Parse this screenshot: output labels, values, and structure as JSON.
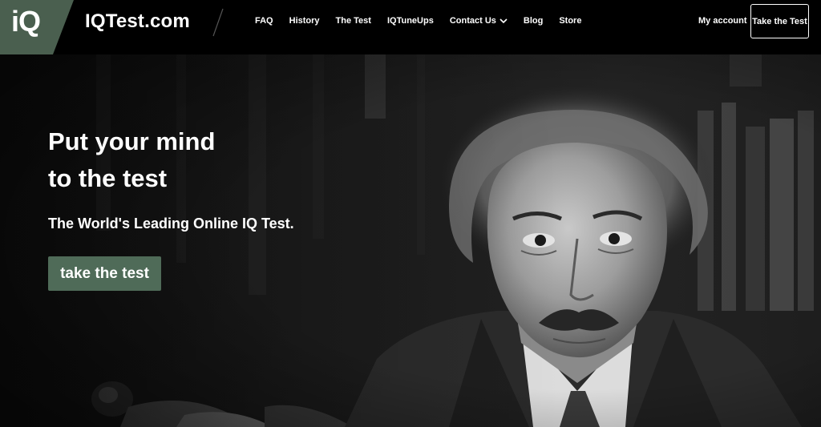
{
  "header": {
    "logo_badge_text": "iQ",
    "brand_name": "IQTest.com",
    "nav": [
      {
        "label": "FAQ"
      },
      {
        "label": "History"
      },
      {
        "label": "The Test"
      },
      {
        "label": "IQTuneUps"
      },
      {
        "label": "Contact Us",
        "has_dropdown": true
      },
      {
        "label": "Blog"
      },
      {
        "label": "Store"
      }
    ],
    "account_label": "My account",
    "cta_label": "Take the Test"
  },
  "hero": {
    "title_line1": "Put your mind",
    "title_line2": "to the test",
    "subtitle": "The World's Leading Online IQ Test.",
    "cta_label": "take the test"
  },
  "colors": {
    "header_bg": "#000000",
    "logo_badge": "#4a5f4f",
    "cta_green": "#4f6b58",
    "text": "#ffffff"
  }
}
